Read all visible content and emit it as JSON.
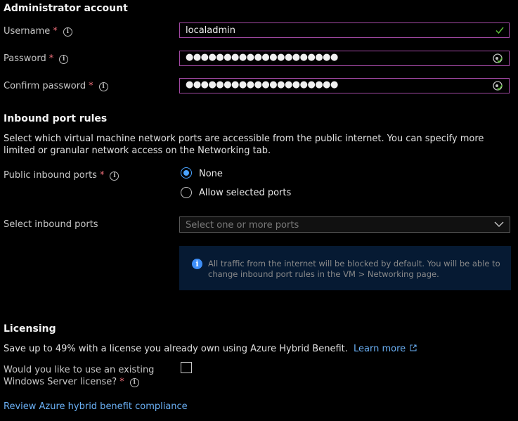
{
  "admin": {
    "heading": "Administrator account",
    "username_label": "Username",
    "username_value": "localadmin",
    "password_label": "Password",
    "password_mask": "●●●●●●●●●●●●●●●●●●●●",
    "confirm_label": "Confirm password",
    "confirm_mask": "●●●●●●●●●●●●●●●●●●●●",
    "required_mark": "*",
    "info_glyph": "i"
  },
  "inbound": {
    "heading": "Inbound port rules",
    "description": "Select which virtual machine network ports are accessible from the public internet. You can specify more limited or granular network access on the Networking tab.",
    "public_label": "Public inbound ports",
    "options": [
      "None",
      "Allow selected ports"
    ],
    "selected_option": "None",
    "select_label": "Select inbound ports",
    "select_placeholder": "Select one or more ports",
    "info_message": "All traffic from the internet will be blocked by default. You will be able to change inbound port rules in the VM > Networking page."
  },
  "licensing": {
    "heading": "Licensing",
    "description": "Save up to 49% with a license you already own using Azure Hybrid Benefit.",
    "learn_more": "Learn more",
    "question_line1": "Would you like to use an existing",
    "question_line2": "Windows Server license?",
    "review_link": "Review Azure hybrid benefit compliance"
  },
  "colors": {
    "accent": "#4aa3ff",
    "required": "#f1707b",
    "field_border_valid": "#a349a4",
    "valid_check": "#5fbf3a",
    "info_box_bg": "#061a33"
  },
  "icons": [
    "info-icon",
    "checkmark-icon",
    "password-reveal-icon",
    "chevron-down-icon",
    "external-link-icon"
  ]
}
